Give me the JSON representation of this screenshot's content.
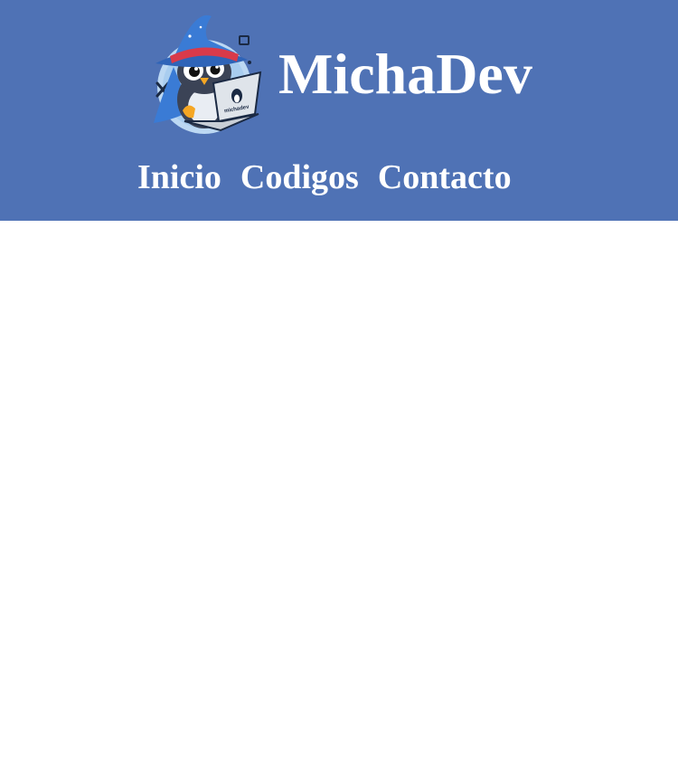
{
  "site": {
    "title": "MichaDev",
    "logo_icon": "wizard-penguin-laptop-logo",
    "logo_laptop_text": "michadev"
  },
  "nav": {
    "items": [
      {
        "label": "Inicio"
      },
      {
        "label": "Codigos"
      },
      {
        "label": "Contacto"
      }
    ]
  },
  "colors": {
    "header_bg": "#4f72b5",
    "text": "#ffffff",
    "page_bg": "#ffffff"
  }
}
